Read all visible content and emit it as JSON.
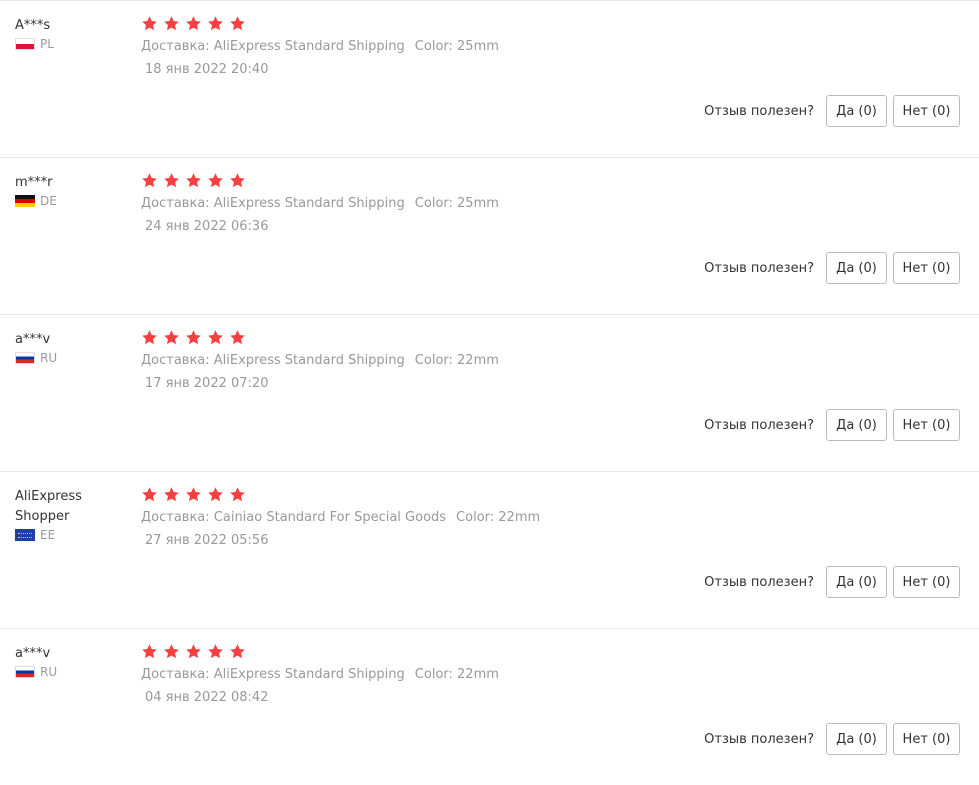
{
  "reviews": [
    {
      "user": "A***s",
      "country": "PL",
      "flag": "pl",
      "rating": 5,
      "delivery": "Доставка: AliExpress Standard Shipping",
      "color": "Color: 25mm",
      "date": "18 янв 2022 20:40",
      "helpful_label": "Отзыв полезен?",
      "yes": "Да (0)",
      "no": "Нет (0)"
    },
    {
      "user": "m***r",
      "country": "DE",
      "flag": "de",
      "rating": 5,
      "delivery": "Доставка: AliExpress Standard Shipping",
      "color": "Color: 25mm",
      "date": "24 янв 2022 06:36",
      "helpful_label": "Отзыв полезен?",
      "yes": "Да (0)",
      "no": "Нет (0)"
    },
    {
      "user": "a***v",
      "country": "RU",
      "flag": "ru",
      "rating": 5,
      "delivery": "Доставка: AliExpress Standard Shipping",
      "color": "Color: 22mm",
      "date": "17 янв 2022 07:20",
      "helpful_label": "Отзыв полезен?",
      "yes": "Да (0)",
      "no": "Нет (0)"
    },
    {
      "user": "AliExpress Shopper",
      "country": "EE",
      "flag": "eu",
      "rating": 5,
      "delivery": "Доставка: Cainiao Standard For Special Goods",
      "color": "Color: 22mm",
      "date": "27 янв 2022 05:56",
      "helpful_label": "Отзыв полезен?",
      "yes": "Да (0)",
      "no": "Нет (0)"
    },
    {
      "user": "a***v",
      "country": "RU",
      "flag": "ru",
      "rating": 5,
      "delivery": "Доставка: AliExpress Standard Shipping",
      "color": "Color: 22mm",
      "date": "04 янв 2022 08:42",
      "helpful_label": "Отзыв полезен?",
      "yes": "Да (0)",
      "no": "Нет (0)"
    }
  ],
  "star_color": "#f44040",
  "star_icon": "star-icon"
}
